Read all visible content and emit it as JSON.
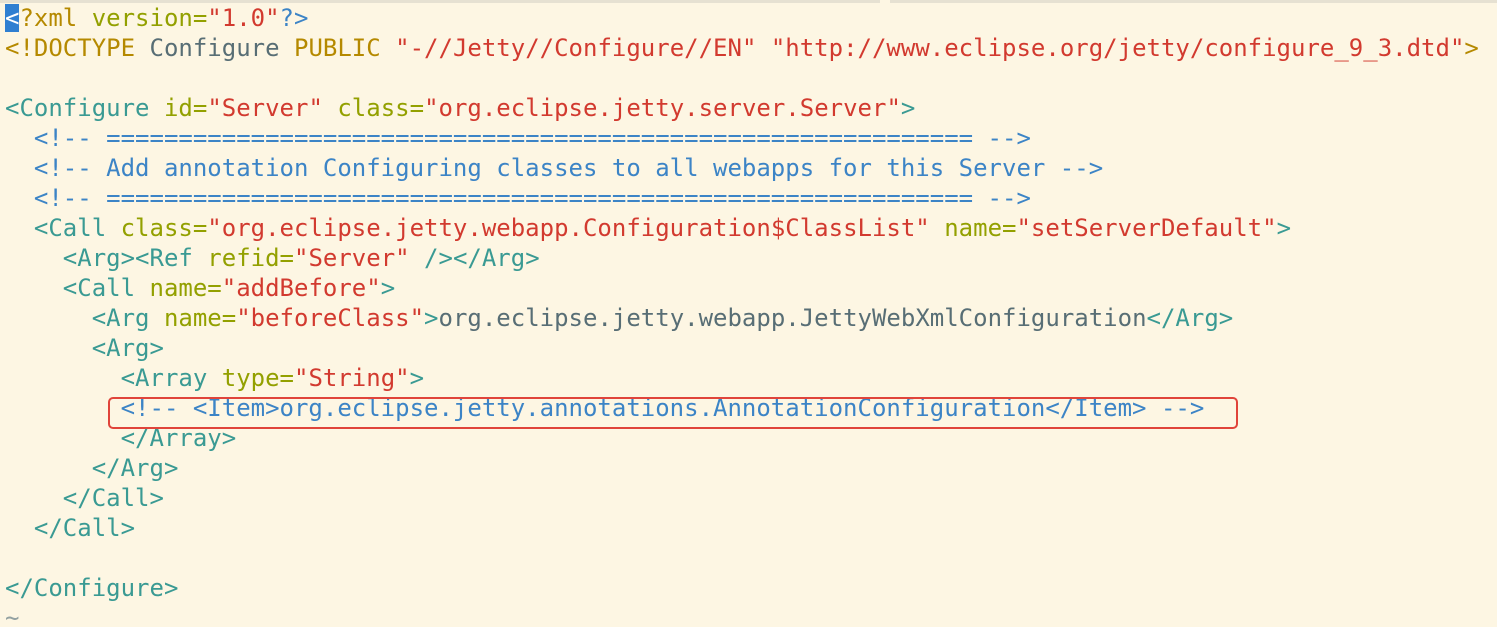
{
  "colors": {
    "background": "#fdf6e3",
    "plain": "#586e75",
    "tag": "#3a9a93",
    "attr": "#93a000",
    "value": "#d23a2f",
    "string": "#d23a2f",
    "comment": "#3c84c6",
    "keyword": "#b58900",
    "highlight_box": "#e0443a",
    "cursor_bg": "#2f7fd1"
  },
  "lines": [
    [
      {
        "t": "<",
        "c": "cursor"
      },
      {
        "t": "?xml ",
        "c": "keyword"
      },
      {
        "t": "version=",
        "c": "attr"
      },
      {
        "t": "\"1.0\"",
        "c": "value"
      },
      {
        "t": "?>",
        "c": "comment"
      }
    ],
    [
      {
        "t": "<!DOCTYPE ",
        "c": "keyword"
      },
      {
        "t": "Configure ",
        "c": "plain"
      },
      {
        "t": "PUBLIC ",
        "c": "keyword"
      },
      {
        "t": "\"-//Jetty//Configure//EN\" \"http://www.eclipse.org/jetty/configure_9_3.dtd\"",
        "c": "string"
      },
      {
        "t": ">",
        "c": "keyword"
      }
    ],
    [],
    [
      {
        "t": "<Configure ",
        "c": "tag"
      },
      {
        "t": "id=",
        "c": "attr"
      },
      {
        "t": "\"Server\" ",
        "c": "value"
      },
      {
        "t": "class=",
        "c": "attr"
      },
      {
        "t": "\"org.eclipse.jetty.server.Server\"",
        "c": "value"
      },
      {
        "t": ">",
        "c": "tag"
      }
    ],
    [
      {
        "t": "  <!-- ============================================================ -->",
        "c": "comment"
      }
    ],
    [
      {
        "t": "  <!-- Add annotation Configuring classes to all webapps for this Server -->",
        "c": "comment"
      }
    ],
    [
      {
        "t": "  <!-- ============================================================ -->",
        "c": "comment"
      }
    ],
    [
      {
        "t": "  <Call ",
        "c": "tag"
      },
      {
        "t": "class=",
        "c": "attr"
      },
      {
        "t": "\"org.eclipse.jetty.webapp.Configuration$ClassList\" ",
        "c": "value"
      },
      {
        "t": "name=",
        "c": "attr"
      },
      {
        "t": "\"setServerDefault\"",
        "c": "value"
      },
      {
        "t": ">",
        "c": "tag"
      }
    ],
    [
      {
        "t": "    <Arg><Ref ",
        "c": "tag"
      },
      {
        "t": "refid=",
        "c": "attr"
      },
      {
        "t": "\"Server\" ",
        "c": "value"
      },
      {
        "t": "/></Arg>",
        "c": "tag"
      }
    ],
    [
      {
        "t": "    <Call ",
        "c": "tag"
      },
      {
        "t": "name=",
        "c": "attr"
      },
      {
        "t": "\"addBefore\"",
        "c": "value"
      },
      {
        "t": ">",
        "c": "tag"
      }
    ],
    [
      {
        "t": "      <Arg ",
        "c": "tag"
      },
      {
        "t": "name=",
        "c": "attr"
      },
      {
        "t": "\"beforeClass\"",
        "c": "value"
      },
      {
        "t": ">",
        "c": "tag"
      },
      {
        "t": "org.eclipse.jetty.webapp.JettyWebXmlConfiguration",
        "c": "plain"
      },
      {
        "t": "</Arg>",
        "c": "tag"
      }
    ],
    [
      {
        "t": "      <Arg>",
        "c": "tag"
      }
    ],
    [
      {
        "t": "        <Array ",
        "c": "tag"
      },
      {
        "t": "type=",
        "c": "attr"
      },
      {
        "t": "\"String\"",
        "c": "value"
      },
      {
        "t": ">",
        "c": "tag"
      }
    ],
    [
      {
        "t": "        <!-- <Item>org.eclipse.jetty.annotations.AnnotationConfiguration</Item> -->",
        "c": "comment"
      }
    ],
    [
      {
        "t": "        </Array>",
        "c": "tag"
      }
    ],
    [
      {
        "t": "      </Arg>",
        "c": "tag"
      }
    ],
    [
      {
        "t": "    </Call>",
        "c": "tag"
      }
    ],
    [
      {
        "t": "  </Call>",
        "c": "tag"
      }
    ],
    [],
    [
      {
        "t": "</Configure>",
        "c": "tag"
      }
    ],
    [
      {
        "t": "~",
        "c": "tilde"
      }
    ]
  ]
}
